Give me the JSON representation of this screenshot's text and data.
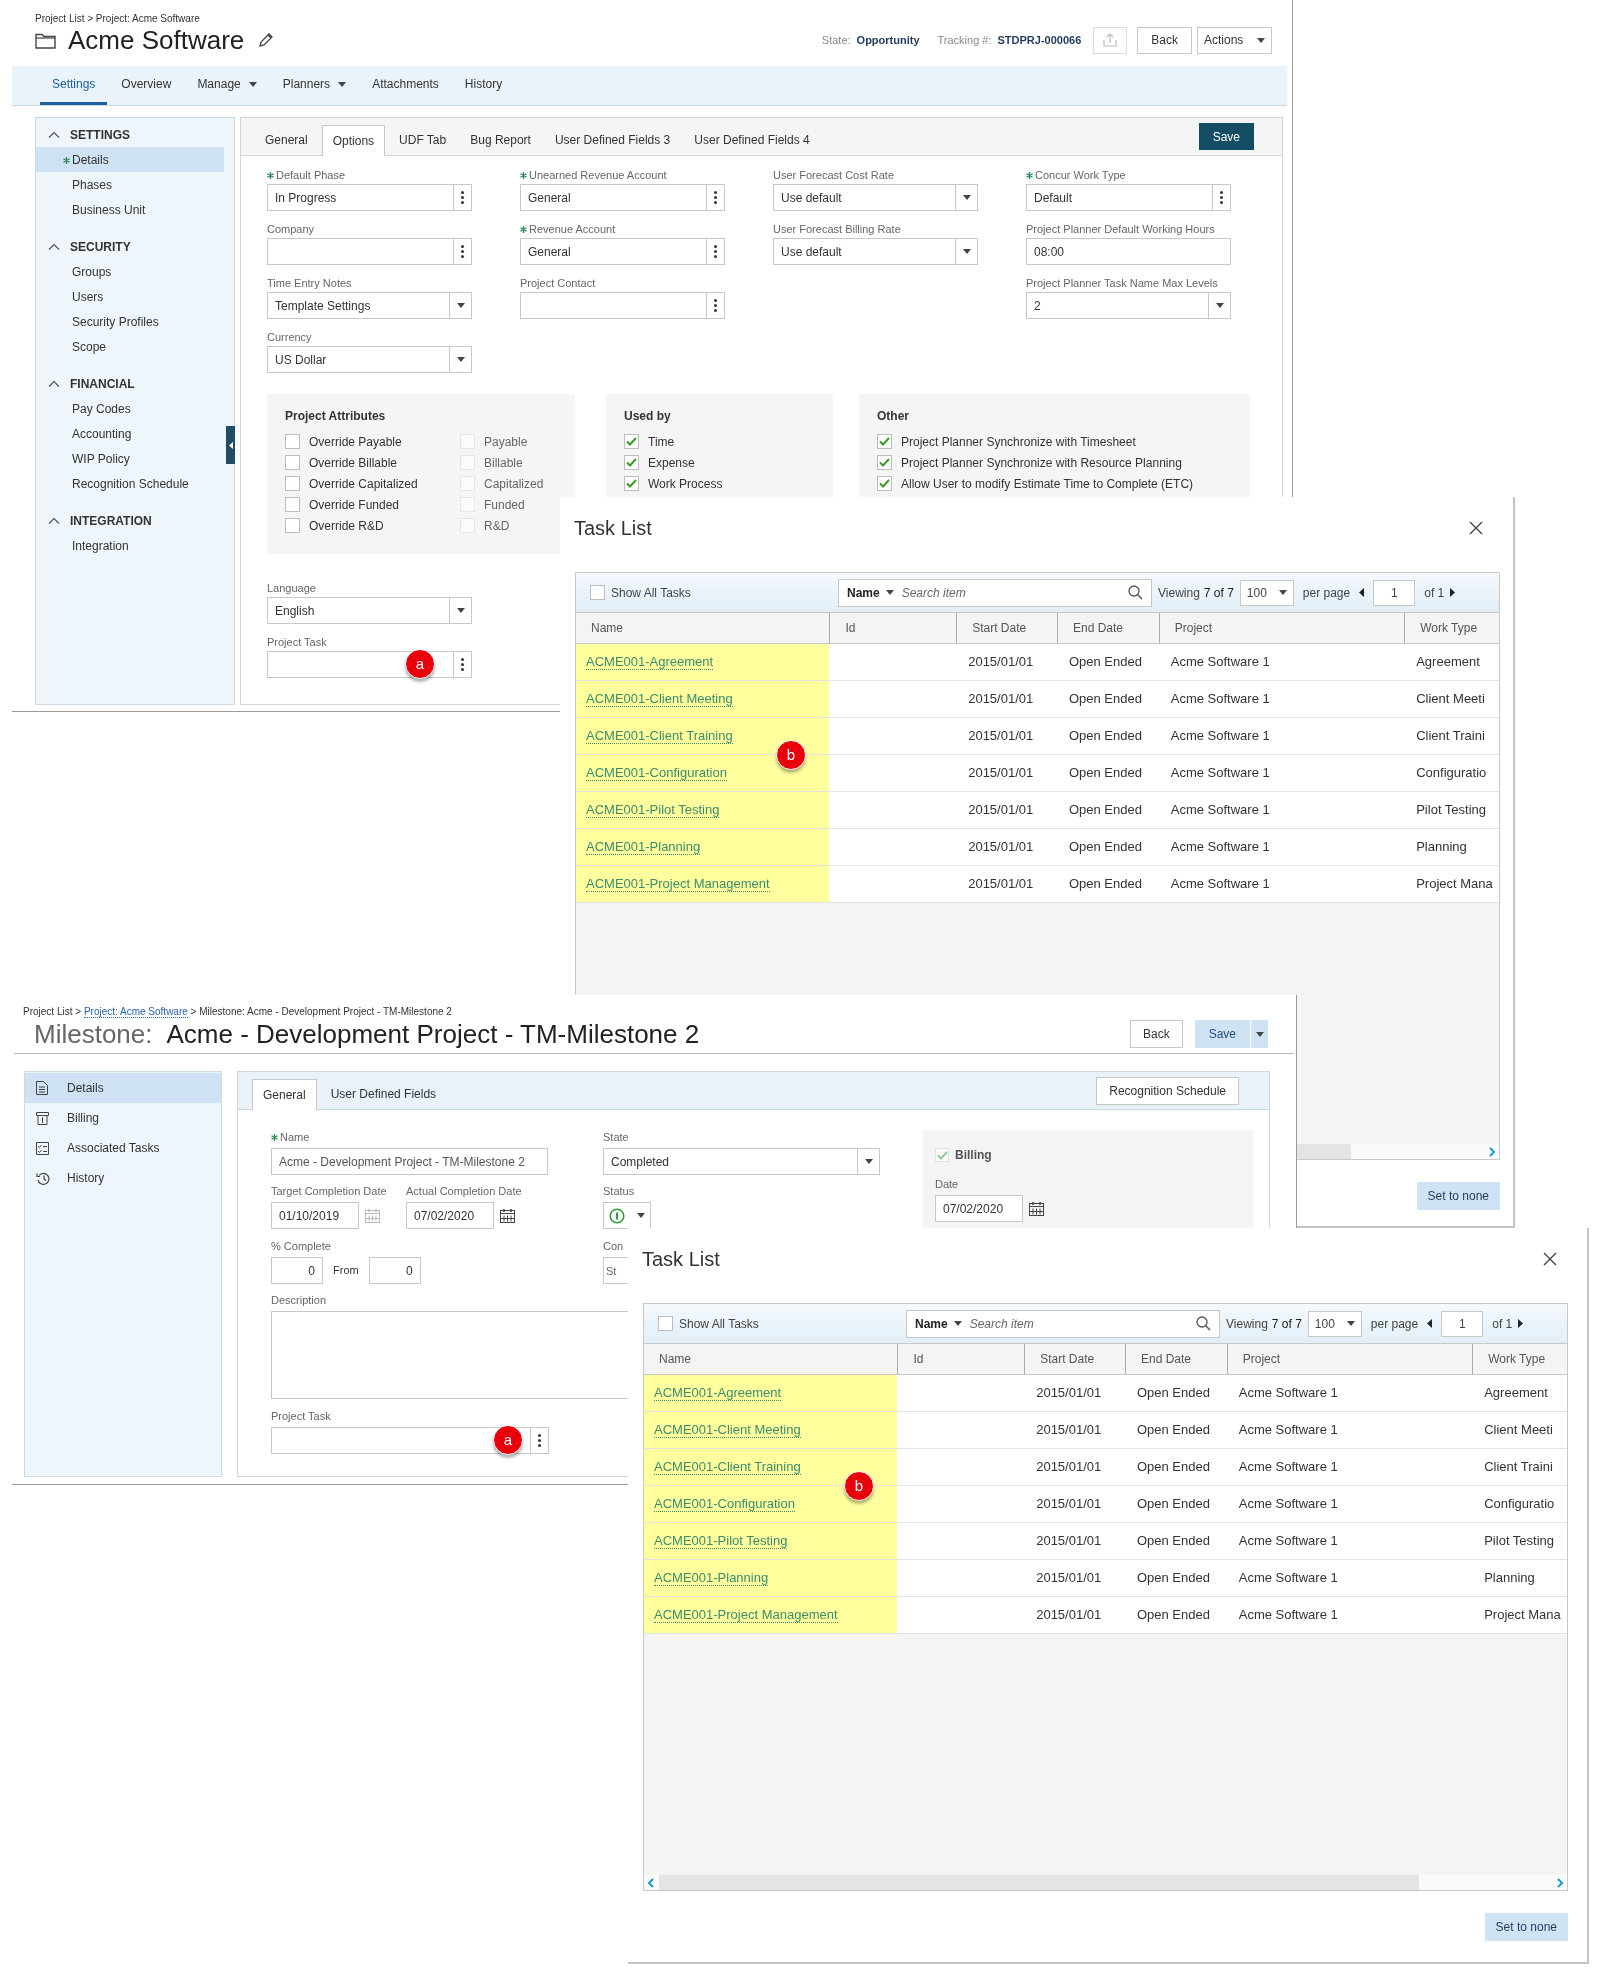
{
  "project": {
    "breadcrumb": "Project List > Project: Acme Software",
    "title": "Acme Software",
    "state_label": "State:",
    "state_value": "Opportunity",
    "tracking_label": "Tracking #:",
    "tracking_value": "STDPRJ-000066",
    "back_button": "Back",
    "actions_button": "Actions",
    "tabs": [
      {
        "label": "Settings",
        "selected": true,
        "dropdown": false
      },
      {
        "label": "Overview",
        "selected": false,
        "dropdown": false
      },
      {
        "label": "Manage",
        "selected": false,
        "dropdown": true
      },
      {
        "label": "Planners",
        "selected": false,
        "dropdown": true
      },
      {
        "label": "Attachments",
        "selected": false,
        "dropdown": false
      },
      {
        "label": "History",
        "selected": false,
        "dropdown": false
      }
    ],
    "sidebar": [
      {
        "title": "SETTINGS",
        "expanded": true,
        "items": [
          {
            "label": "Details",
            "selected": true
          },
          {
            "label": "Phases",
            "selected": false
          },
          {
            "label": "Business Unit",
            "selected": false
          }
        ]
      },
      {
        "title": "SECURITY",
        "expanded": true,
        "items": [
          {
            "label": "Groups",
            "selected": false
          },
          {
            "label": "Users",
            "selected": false
          },
          {
            "label": "Security Profiles",
            "selected": false
          },
          {
            "label": "Scope",
            "selected": false
          }
        ]
      },
      {
        "title": "FINANCIAL",
        "expanded": true,
        "items": [
          {
            "label": "Pay Codes",
            "selected": false
          },
          {
            "label": "Accounting",
            "selected": false
          },
          {
            "label": "WIP Policy",
            "selected": false
          },
          {
            "label": "Recognition Schedule",
            "selected": false
          }
        ]
      },
      {
        "title": "INTEGRATION",
        "expanded": true,
        "items": [
          {
            "label": "Integration",
            "selected": false
          }
        ]
      }
    ],
    "subtabs": [
      {
        "label": "General",
        "selected": false
      },
      {
        "label": "Options",
        "selected": true
      },
      {
        "label": "UDF Tab",
        "selected": false
      },
      {
        "label": "Bug Report",
        "selected": false
      },
      {
        "label": "User Defined Fields 3",
        "selected": false
      },
      {
        "label": "User Defined Fields 4",
        "selected": false
      }
    ],
    "save_button": "Save",
    "field_columns": [
      [
        {
          "label": "Default Phase",
          "required": true,
          "value": "In Progress",
          "kind": "lookup"
        },
        {
          "label": "Company",
          "required": false,
          "kind": "lookup"
        },
        {
          "label": "Time Entry Notes",
          "required": false,
          "value": "Template Settings",
          "kind": "select"
        },
        {
          "label": "Currency",
          "required": false,
          "value": "US Dollar",
          "kind": "select"
        }
      ],
      [
        {
          "label": "Unearned Revenue Account",
          "required": true,
          "value": "General",
          "kind": "lookup"
        },
        {
          "label": "Revenue Account",
          "required": true,
          "value": "General",
          "kind": "lookup"
        },
        {
          "label": "Project Contact",
          "required": false,
          "kind": "lookup"
        }
      ],
      [
        {
          "label": "User Forecast Cost Rate",
          "required": false,
          "value": "Use default",
          "kind": "select"
        },
        {
          "label": "User Forecast Billing Rate",
          "required": false,
          "value": "Use default",
          "kind": "select"
        }
      ],
      [
        {
          "label": "Concur Work Type",
          "required": true,
          "value": "Default",
          "kind": "lookup"
        },
        {
          "label": "Project Planner Default Working Hours",
          "required": false,
          "value": "08:00",
          "kind": "text"
        },
        {
          "label": "Project Planner Task Name Max Levels",
          "required": false,
          "value": "2",
          "kind": "select"
        }
      ]
    ],
    "attribute_groups": [
      {
        "title": "Project Attributes",
        "columns": [
          [
            {
              "label": "Override Payable",
              "checked": false,
              "disabled": false
            },
            {
              "label": "Override Billable",
              "checked": false,
              "disabled": false
            },
            {
              "label": "Override Capitalized",
              "checked": false,
              "disabled": false
            },
            {
              "label": "Override Funded",
              "checked": false,
              "disabled": false
            },
            {
              "label": "Override R&D",
              "checked": false,
              "disabled": false
            }
          ],
          [
            {
              "label": "Payable",
              "checked": false,
              "disabled": true
            },
            {
              "label": "Billable",
              "checked": false,
              "disabled": true
            },
            {
              "label": "Capitalized",
              "checked": false,
              "disabled": true
            },
            {
              "label": "Funded",
              "checked": false,
              "disabled": true
            },
            {
              "label": "R&D",
              "checked": false,
              "disabled": true
            }
          ]
        ]
      },
      {
        "title": "Used by",
        "columns": [
          [
            {
              "label": "Time",
              "checked": true,
              "disabled": false
            },
            {
              "label": "Expense",
              "checked": true,
              "disabled": false
            },
            {
              "label": "Work Process",
              "checked": true,
              "disabled": false
            }
          ]
        ]
      },
      {
        "title": "Other",
        "columns": [
          [
            {
              "label": "Project Planner Synchronize with Timesheet",
              "checked": true,
              "disabled": false
            },
            {
              "label": "Project Planner Synchronize with Resource Planning",
              "checked": true,
              "disabled": false
            },
            {
              "label": "Allow User to modify Estimate Time to Complete (ETC)",
              "checked": true,
              "disabled": false
            }
          ]
        ]
      }
    ],
    "language": {
      "label": "Language",
      "value": "English"
    },
    "project_task": {
      "label": "Project Task",
      "marker": "a"
    }
  },
  "task_lists": [
    {
      "title": "Task List",
      "show_all": {
        "label": "Show All Tasks",
        "checked": false
      },
      "search_scope": "Name",
      "search_placeholder": "Search item",
      "viewing_label": "Viewing",
      "viewing_count": "7 of 7",
      "per_page_value": "100",
      "per_page_label": "per page",
      "page": "1",
      "page_total": "of 1",
      "columns": [
        {
          "label": "Name",
          "highlighted": true
        },
        {
          "label": "Id",
          "highlighted": false
        },
        {
          "label": "Start Date",
          "highlighted": false
        },
        {
          "label": "End Date",
          "highlighted": false
        },
        {
          "label": "Project",
          "highlighted": false
        },
        {
          "label": "Work Type",
          "highlighted": false
        }
      ],
      "rows": [
        {
          "name": "ACME001-Agreement",
          "start_date": "2015/01/01",
          "end_date": "Open Ended",
          "project": "Acme Software 1",
          "work_type": "Agreement"
        },
        {
          "name": "ACME001-Client Meeting",
          "start_date": "2015/01/01",
          "end_date": "Open Ended",
          "project": "Acme Software 1",
          "work_type": "Client Meeti"
        },
        {
          "name": "ACME001-Client Training",
          "start_date": "2015/01/01",
          "end_date": "Open Ended",
          "project": "Acme Software 1",
          "work_type": "Client Traini"
        },
        {
          "name": "ACME001-Configuration",
          "start_date": "2015/01/01",
          "end_date": "Open Ended",
          "project": "Acme Software 1",
          "work_type": "Configuratio"
        },
        {
          "name": "ACME001-Pilot Testing",
          "start_date": "2015/01/01",
          "end_date": "Open Ended",
          "project": "Acme Software 1",
          "work_type": "Pilot Testing"
        },
        {
          "name": "ACME001-Planning",
          "start_date": "2015/01/01",
          "end_date": "Open Ended",
          "project": "Acme Software 1",
          "work_type": "Planning"
        },
        {
          "name": "ACME001-Project Management",
          "start_date": "2015/01/01",
          "end_date": "Open Ended",
          "project": "Acme Software 1",
          "work_type": "Project Mana"
        }
      ],
      "marker": "b",
      "set_none_button": "Set to none"
    },
    {
      "title": "Task List",
      "show_all": {
        "label": "Show All Tasks",
        "checked": false
      },
      "search_scope": "Name",
      "search_placeholder": "Search item",
      "viewing_label": "Viewing",
      "viewing_count": "7 of 7",
      "per_page_value": "100",
      "per_page_label": "per page",
      "page": "1",
      "page_total": "of 1",
      "columns": [
        {
          "label": "Name",
          "highlighted": true
        },
        {
          "label": "Id",
          "highlighted": false
        },
        {
          "label": "Start Date",
          "highlighted": false
        },
        {
          "label": "End Date",
          "highlighted": false
        },
        {
          "label": "Project",
          "highlighted": false
        },
        {
          "label": "Work Type",
          "highlighted": false
        }
      ],
      "rows": [
        {
          "name": "ACME001-Agreement",
          "start_date": "2015/01/01",
          "end_date": "Open Ended",
          "project": "Acme Software 1",
          "work_type": "Agreement"
        },
        {
          "name": "ACME001-Client Meeting",
          "start_date": "2015/01/01",
          "end_date": "Open Ended",
          "project": "Acme Software 1",
          "work_type": "Client Meeti"
        },
        {
          "name": "ACME001-Client Training",
          "start_date": "2015/01/01",
          "end_date": "Open Ended",
          "project": "Acme Software 1",
          "work_type": "Client Traini"
        },
        {
          "name": "ACME001-Configuration",
          "start_date": "2015/01/01",
          "end_date": "Open Ended",
          "project": "Acme Software 1",
          "work_type": "Configuratio"
        },
        {
          "name": "ACME001-Pilot Testing",
          "start_date": "2015/01/01",
          "end_date": "Open Ended",
          "project": "Acme Software 1",
          "work_type": "Pilot Testing"
        },
        {
          "name": "ACME001-Planning",
          "start_date": "2015/01/01",
          "end_date": "Open Ended",
          "project": "Acme Software 1",
          "work_type": "Planning"
        },
        {
          "name": "ACME001-Project Management",
          "start_date": "2015/01/01",
          "end_date": "Open Ended",
          "project": "Acme Software 1",
          "work_type": "Project Mana"
        }
      ],
      "marker": "b",
      "set_none_button": "Set to none"
    }
  ],
  "milestone": {
    "breadcrumb": [
      {
        "text": "Project List",
        "link": false
      },
      {
        "text": "Project: Acme Software",
        "link": true
      },
      {
        "text": "Milestone: Acme - Development Project - TM-Milestone 2",
        "link": false
      }
    ],
    "breadcrumb_separator": ">",
    "title_prefix": "Milestone:",
    "title": "Acme - Development Project - TM-Milestone 2",
    "back_button": "Back",
    "save_button": "Save",
    "sidebar": [
      {
        "label": "Details",
        "selected": true
      },
      {
        "label": "Billing",
        "selected": false
      },
      {
        "label": "Associated Tasks",
        "selected": false
      },
      {
        "label": "History",
        "selected": false
      }
    ],
    "tabs": [
      {
        "label": "General",
        "selected": true
      },
      {
        "label": "User Defined Fields",
        "selected": false
      }
    ],
    "recognition_button": "Recognition Schedule",
    "name_field": {
      "label": "Name",
      "required": true,
      "value": "Acme - Development Project - TM-Milestone 2"
    },
    "target_date": {
      "label": "Target Completion Date",
      "value": "01/10/2019",
      "disabled": true
    },
    "actual_date": {
      "label": "Actual Completion Date",
      "value": "07/02/2020",
      "disabled": false
    },
    "percent_complete": {
      "label": "% Complete",
      "value": "0"
    },
    "from": {
      "label": "From",
      "value": "0"
    },
    "description": {
      "label": "Description"
    },
    "project_task": {
      "label": "Project Task",
      "marker": "a"
    },
    "state": {
      "label": "State",
      "value": "Completed"
    },
    "status": {
      "label": "Status"
    },
    "cut_field": {
      "label": "Con",
      "value": "St"
    },
    "billing": {
      "label": "Billing",
      "checked": true
    },
    "billing_date": {
      "label": "Date",
      "value": "07/02/2020"
    }
  }
}
